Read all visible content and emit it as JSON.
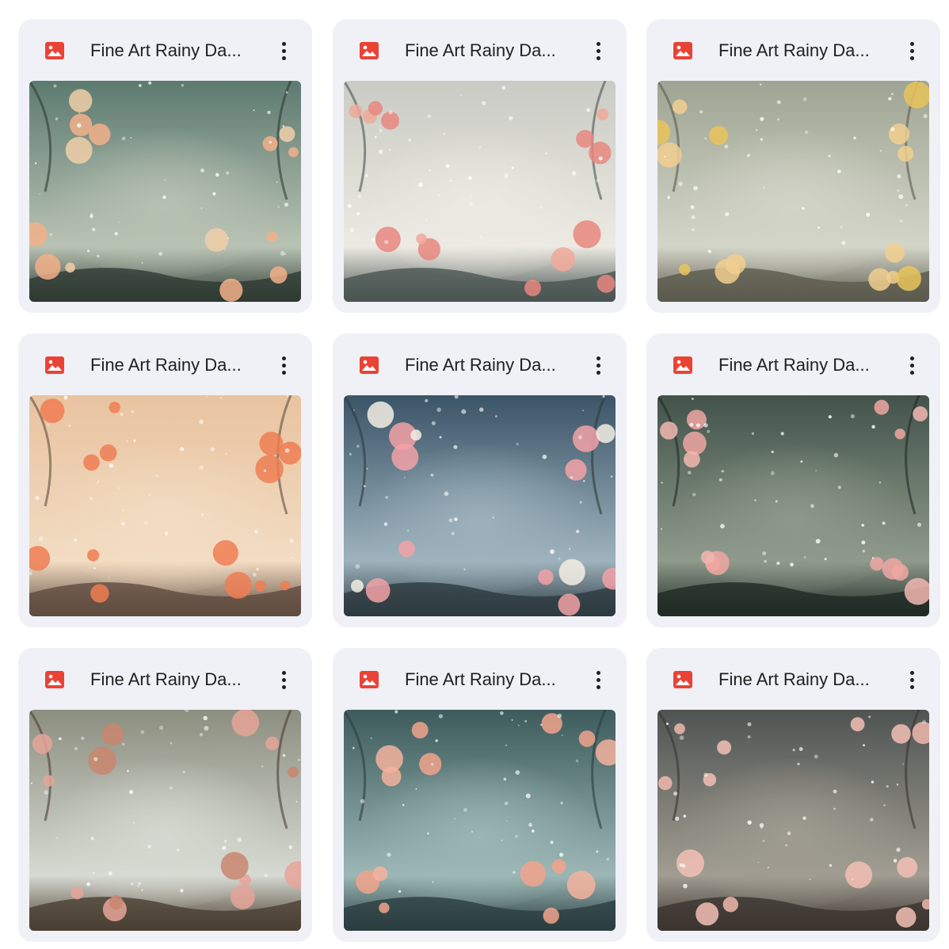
{
  "files": [
    {
      "title": "Fine Art Rainy Da...",
      "icon": "image-file-icon",
      "palette": {
        "sky": "#5d7a70",
        "mist": "#b9c3b4",
        "accent": "#f0cfa8",
        "ground": "#2e3a33",
        "flower": "#f2b08a"
      }
    },
    {
      "title": "Fine Art Rainy Da...",
      "icon": "image-file-icon",
      "palette": {
        "sky": "#c9cbc4",
        "mist": "#eceae2",
        "accent": "#f0a99b",
        "ground": "#4a5553",
        "flower": "#e8877f"
      }
    },
    {
      "title": "Fine Art Rainy Da...",
      "icon": "image-file-icon",
      "palette": {
        "sky": "#9ea493",
        "mist": "#d3d5c8",
        "accent": "#e9c45a",
        "ground": "#5b5a4e",
        "flower": "#f1cf8f"
      }
    },
    {
      "title": "Fine Art Rainy Da...",
      "icon": "image-file-icon",
      "palette": {
        "sky": "#e8c3a0",
        "mist": "#f2dcc2",
        "accent": "#f07d52",
        "ground": "#5f4b3f",
        "flower": "#ee7e54"
      }
    },
    {
      "title": "Fine Art Rainy Da...",
      "icon": "image-file-icon",
      "palette": {
        "sky": "#3b5467",
        "mist": "#9eb3bd",
        "accent": "#f3efe4",
        "ground": "#2d3a40",
        "flower": "#f2a2a6"
      }
    },
    {
      "title": "Fine Art Rainy Da...",
      "icon": "image-file-icon",
      "palette": {
        "sky": "#42534a",
        "mist": "#8f9a8c",
        "accent": "#f2b7b0",
        "ground": "#1f2a26",
        "flower": "#f0a7a2"
      }
    },
    {
      "title": "Fine Art Rainy Da...",
      "icon": "image-file-icon",
      "palette": {
        "sky": "#8c8e80",
        "mist": "#d7dad2",
        "accent": "#c9866f",
        "ground": "#4a3e32",
        "flower": "#e6a49a"
      }
    },
    {
      "title": "Fine Art Rainy Da...",
      "icon": "image-file-icon",
      "palette": {
        "sky": "#3d5b5c",
        "mist": "#9cb7b5",
        "accent": "#f4b39e",
        "ground": "#2a3d40",
        "flower": "#f1a38c"
      }
    },
    {
      "title": "Fine Art Rainy Da...",
      "icon": "image-file-icon",
      "palette": {
        "sky": "#4f5452",
        "mist": "#a19d92",
        "accent": "#f0b8ad",
        "ground": "#3b3430",
        "flower": "#f3c0b5"
      }
    }
  ],
  "more_icon": "more-vert-icon",
  "icon_color": "#ea4335"
}
